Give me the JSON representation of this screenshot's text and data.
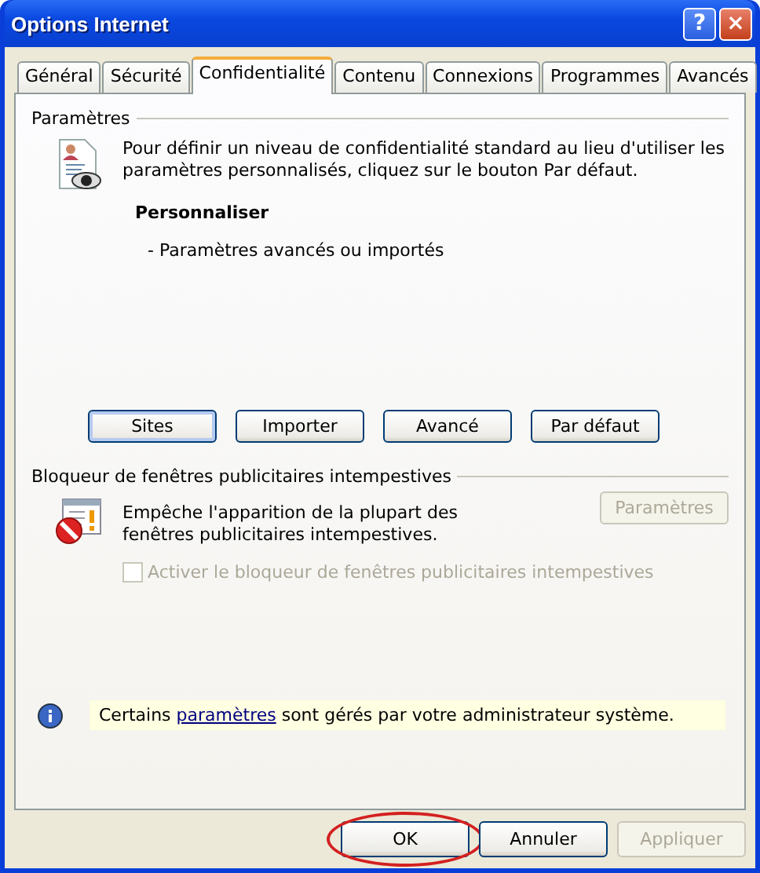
{
  "window": {
    "title": "Options Internet",
    "help_button": "?",
    "close_button": "×"
  },
  "tabs": [
    {
      "label": "Général",
      "selected": false
    },
    {
      "label": "Sécurité",
      "selected": false
    },
    {
      "label": "Confidentialité",
      "selected": true
    },
    {
      "label": "Contenu",
      "selected": false
    },
    {
      "label": "Connexions",
      "selected": false
    },
    {
      "label": "Programmes",
      "selected": false
    },
    {
      "label": "Avancés",
      "selected": false
    }
  ],
  "privacy": {
    "heading": "Paramètres",
    "description": "Pour définir un niveau de confidentialité standard au lieu d'utiliser les paramètres personnalisés, cliquez sur le bouton Par défaut.",
    "level_title": "Personnaliser",
    "level_detail": "- Paramètres avancés ou importés",
    "buttons": [
      {
        "label": "Sites",
        "focused": true
      },
      {
        "label": "Importer",
        "focused": false
      },
      {
        "label": "Avancé",
        "focused": false
      },
      {
        "label": "Par défaut",
        "focused": false
      }
    ]
  },
  "popup_blocker": {
    "heading": "Bloqueur de fenêtres publicitaires intempestives",
    "description": "Empêche l'apparition de la plupart des fenêtres publicitaires intempestives.",
    "settings_button": {
      "label": "Paramètres",
      "disabled": true
    },
    "checkbox": {
      "label": "Activer le bloqueur de fenêtres publicitaires intempestives",
      "checked": false,
      "disabled": true
    }
  },
  "info_bar": {
    "before": "Certains ",
    "link": "paramètres",
    "after": " sont gérés par votre administrateur système."
  },
  "footer_buttons": [
    {
      "label": "OK",
      "disabled": false,
      "highlighted": true
    },
    {
      "label": "Annuler",
      "disabled": false,
      "highlighted": false
    },
    {
      "label": "Appliquer",
      "disabled": true,
      "highlighted": false
    }
  ]
}
